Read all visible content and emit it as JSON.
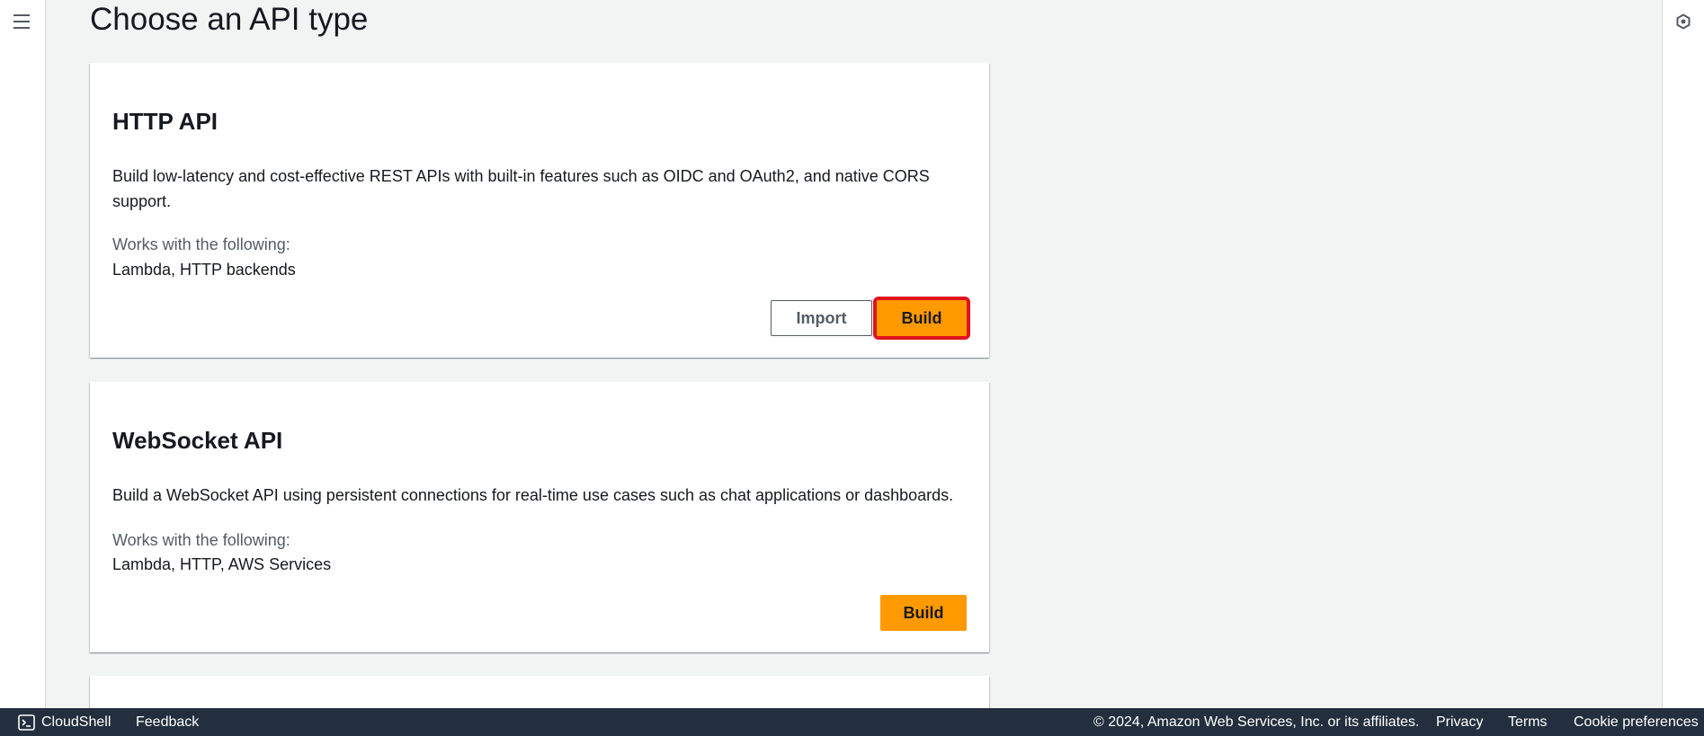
{
  "page": {
    "title": "Choose an API type"
  },
  "cards": [
    {
      "title": "HTTP API",
      "description": "Build low-latency and cost-effective REST APIs with built-in features such as OIDC and OAuth2, and native CORS support.",
      "works_label": "Works with the following:",
      "works_value": "Lambda, HTTP backends",
      "import_label": "Import",
      "build_label": "Build"
    },
    {
      "title": "WebSocket API",
      "description": "Build a WebSocket API using persistent connections for real-time use cases such as chat applications or dashboards.",
      "works_label": "Works with the following:",
      "works_value": "Lambda, HTTP, AWS Services",
      "build_label": "Build"
    }
  ],
  "footer": {
    "cloudshell": "CloudShell",
    "feedback": "Feedback",
    "copyright": "© 2024, Amazon Web Services, Inc. or its affiliates.",
    "privacy": "Privacy",
    "terms": "Terms",
    "cookies": "Cookie preferences"
  },
  "icons": {
    "menu": "hamburger-menu-icon",
    "right_rail": "settings-hexagon-icon",
    "cloudshell": "terminal-icon"
  },
  "colors": {
    "primary_button": "#ff9900",
    "highlight_outline": "#e0141e",
    "footer_bg": "#232f3e",
    "background": "#f2f3f3"
  }
}
